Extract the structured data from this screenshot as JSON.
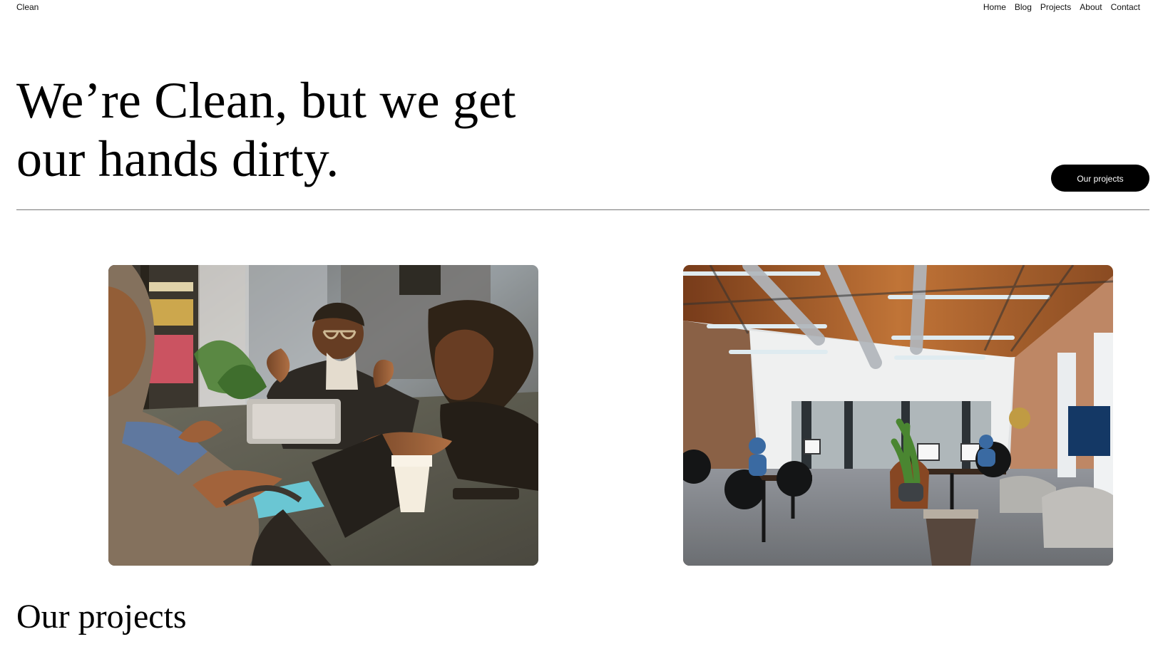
{
  "header": {
    "brand": "Clean",
    "nav": [
      {
        "label": "Home"
      },
      {
        "label": "Blog"
      },
      {
        "label": "Projects"
      },
      {
        "label": "About"
      },
      {
        "label": "Contact"
      }
    ]
  },
  "hero": {
    "title": "We’re Clean, but we get our hands dirty.",
    "button_label": "Our projects"
  },
  "images": [
    {
      "alt": "people meeting around a table with laptops"
    },
    {
      "alt": "open office with desks, chairs, sofa and brick wall"
    }
  ],
  "projects": {
    "title": "Our projects"
  }
}
